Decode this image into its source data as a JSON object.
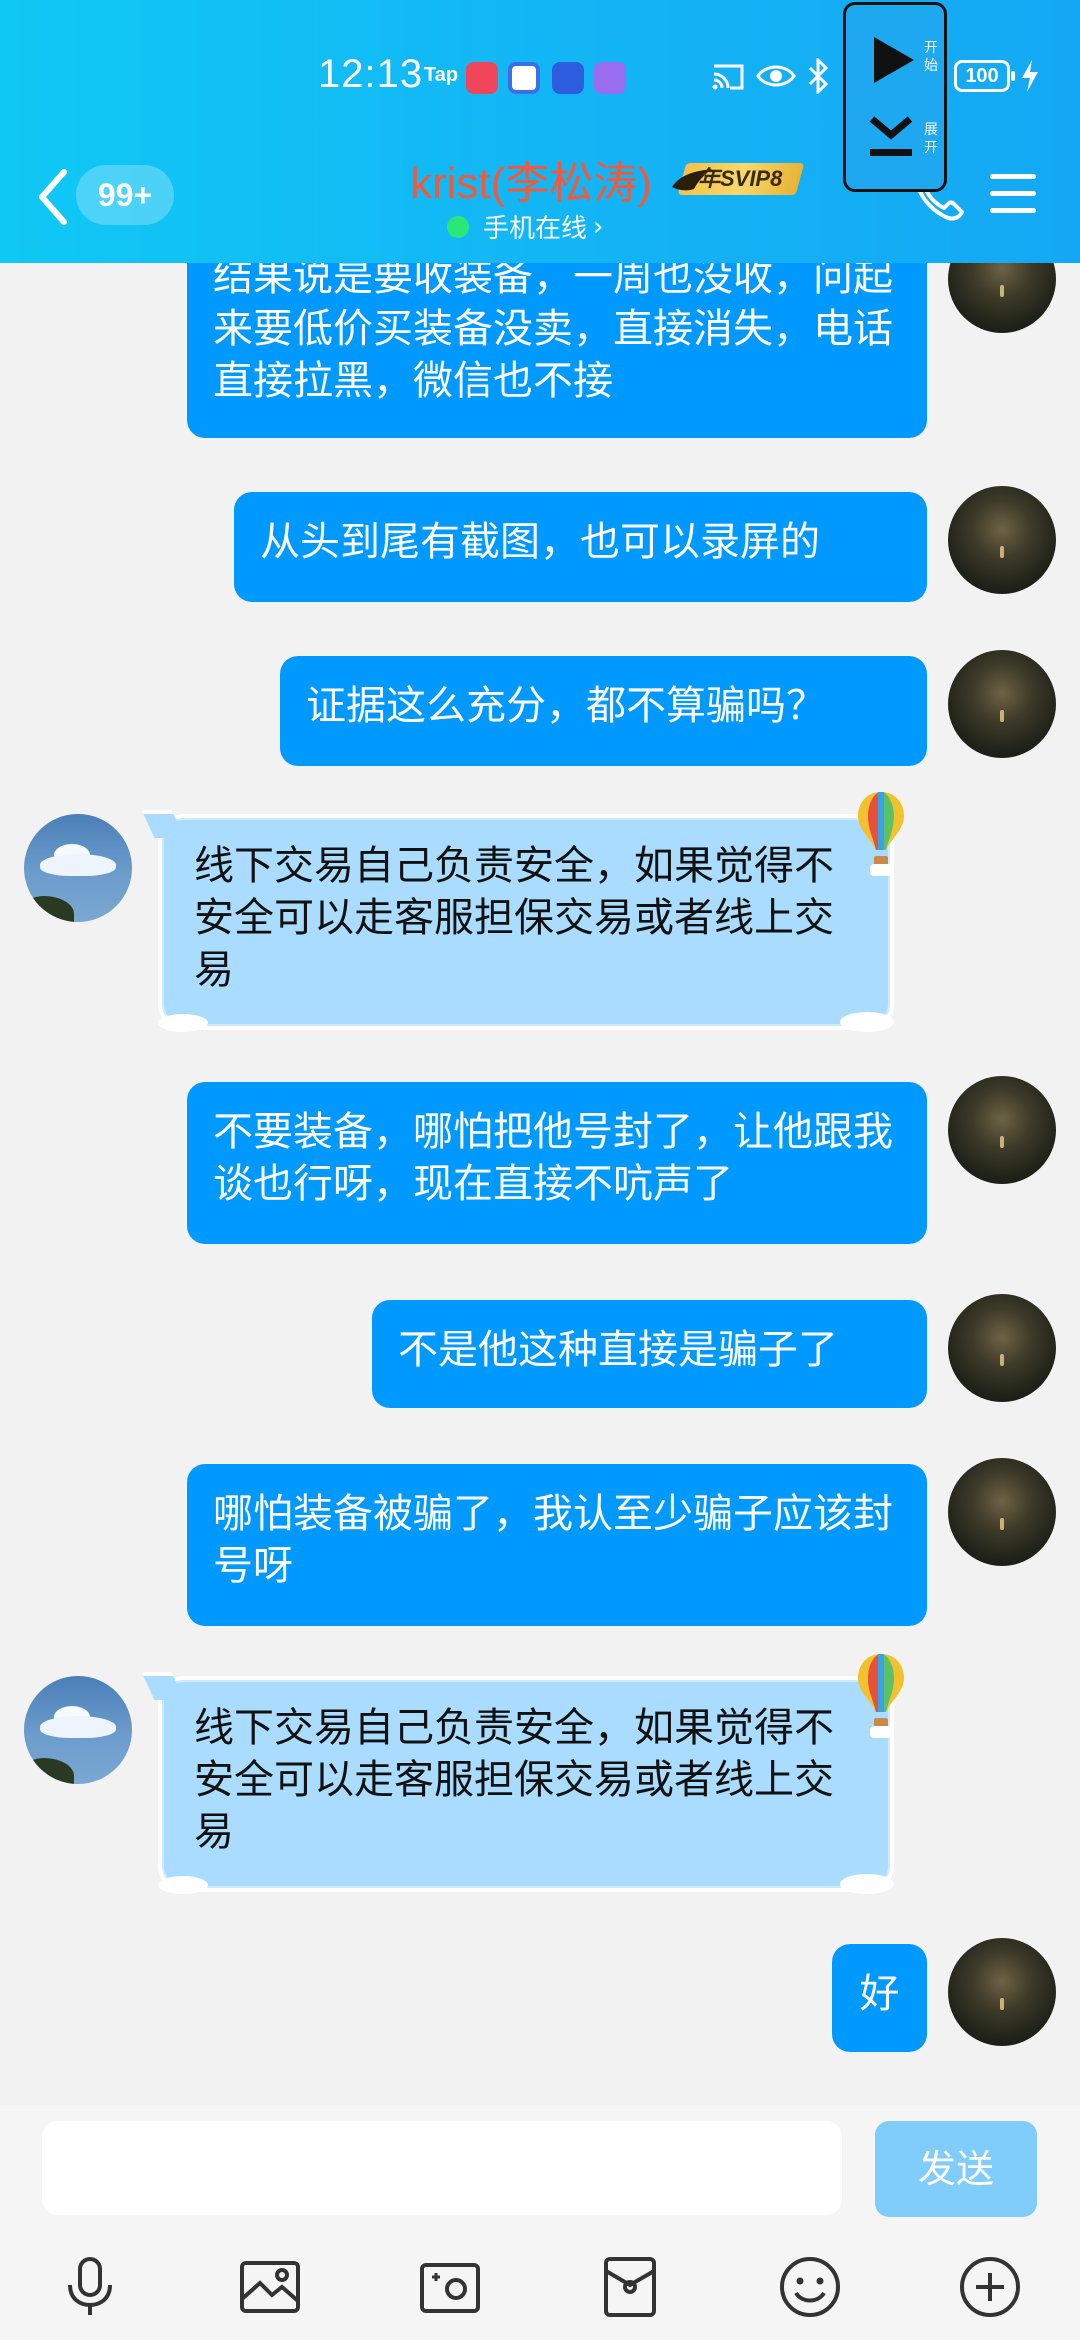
{
  "status_bar": {
    "time": "12:13",
    "tap": "Tap",
    "battery": "100"
  },
  "header": {
    "unread_badge": "99+",
    "title": "krist(李松涛)",
    "vip_badge": "年SVIP8",
    "online_status": "手机在线",
    "online_arrow": "›"
  },
  "floating_widget": {
    "start_label": "开始",
    "expand_label": "展开"
  },
  "messages": [
    {
      "sender": "me",
      "text": "结果说是要收装备，一周也没收，问起来要低价买装备没卖，直接消失，电话直接拉黑，微信也不接"
    },
    {
      "sender": "me",
      "text": "从头到尾有截图，也可以录屏的"
    },
    {
      "sender": "me",
      "text": "证据这么充分，都不算骗吗？"
    },
    {
      "sender": "service",
      "text": "线下交易自己负责安全，如果觉得不安全可以走客服担保交易或者线上交易"
    },
    {
      "sender": "me",
      "text": "不要装备，哪怕把他号封了，让他跟我谈也行呀，现在直接不吭声了"
    },
    {
      "sender": "me",
      "text": "不是他这种直接是骗子了"
    },
    {
      "sender": "me",
      "text": "哪怕装备被骗了，我认至少骗子应该封号呀"
    },
    {
      "sender": "service",
      "text": "线下交易自己负责安全，如果觉得不安全可以走客服担保交易或者线上交易"
    },
    {
      "sender": "me",
      "text": "好"
    }
  ],
  "input": {
    "value": "",
    "placeholder": "",
    "send_label": "发送"
  },
  "toolbar": {
    "icons": [
      "mic-icon",
      "image-icon",
      "camera-icon",
      "red-packet-icon",
      "emoji-icon",
      "plus-icon"
    ]
  },
  "colors": {
    "header_gradient_start": "#10c8f4",
    "header_gradient_end": "#14a8f4",
    "my_bubble": "#0099ff",
    "service_bubble": "#a9dcff",
    "title_color": "#f05a3a",
    "send_button": "#80ccfb",
    "online_dot": "#2de67a"
  }
}
